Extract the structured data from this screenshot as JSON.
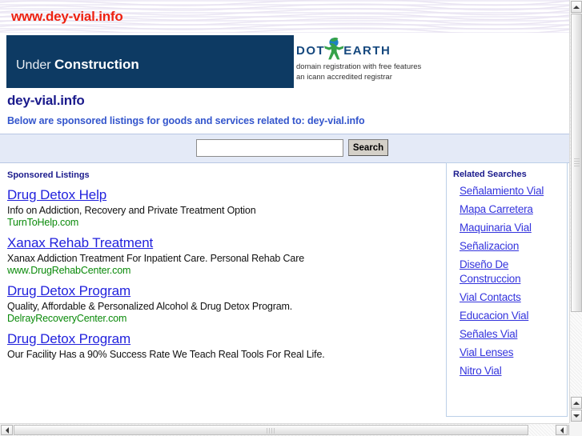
{
  "header": {
    "site_url": "www.dey-vial.info",
    "banner": {
      "prefix": "Under ",
      "emphasis": "Construction"
    },
    "registrar": {
      "logo_left": "DOT",
      "logo_right": "EARTH",
      "logo_icon": "globe-person-icon",
      "tagline": "domain registration with free features",
      "accreditation": "an icann accredited registrar"
    }
  },
  "page": {
    "domain_title": "dey-vial.info",
    "subtitle": "Below are sponsored listings for goods and services related to: dey-vial.info"
  },
  "search": {
    "value": "",
    "placeholder": "",
    "button_label": "Search"
  },
  "listings": {
    "heading": "Sponsored Listings",
    "items": [
      {
        "title": "Drug Detox Help",
        "description": "Info on Addiction, Recovery and Private Treatment Option",
        "url": "TurnToHelp.com"
      },
      {
        "title": "Xanax Rehab Treatment",
        "description": "Xanax Addiction Treatment For Inpatient Care. Personal Rehab Care",
        "url": "www.DrugRehabCenter.com"
      },
      {
        "title": "Drug Detox Program",
        "description": "Quality, Affordable & Personalized Alcohol & Drug Detox Program.",
        "url": "DelrayRecoveryCenter.com"
      },
      {
        "title": "Drug Detox Program",
        "description": "Our Facility Has a 90% Success Rate We Teach Real Tools For Real Life.",
        "url": ""
      }
    ]
  },
  "related": {
    "heading": "Related Searches",
    "items": [
      "Señalamiento Vial",
      "Mapa Carretera",
      "Maquinaria Vial",
      "Señalizacion",
      "Diseño De Construccion",
      "Vial Contacts",
      "Educacion Vial",
      "Señales Vial",
      "Vial Lenses",
      "Nitro Vial"
    ]
  },
  "colors": {
    "url_red": "#ee2211",
    "banner_navy": "#0d3a63",
    "title_navy": "#1a1a8c",
    "subtitle_blue": "#3355cc",
    "link_blue": "#2222dd",
    "url_green": "#0a8a0a",
    "search_band": "#e4eaf7"
  }
}
